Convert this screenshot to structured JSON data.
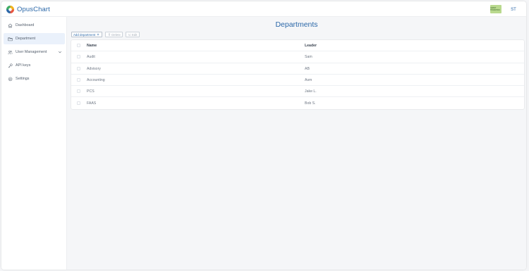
{
  "app": {
    "brand": "OpusChart",
    "org_logo_text": "GRANT THORNTON",
    "user_initials": "ST",
    "accent_color": "#2a67a8"
  },
  "sidebar": {
    "items": [
      {
        "label": "Dashboard",
        "icon": "home-icon"
      },
      {
        "label": "Department",
        "icon": "folder-icon",
        "active": true
      },
      {
        "label": "User Management",
        "icon": "users-icon",
        "expandable": true
      },
      {
        "label": "API keys",
        "icon": "key-icon"
      },
      {
        "label": "Settings",
        "icon": "gear-icon"
      }
    ]
  },
  "page": {
    "title": "Departments",
    "toolbar": {
      "add_label": "Add department",
      "delete_label": "Delete",
      "edit_label": "Edit"
    },
    "table": {
      "columns": [
        "Name",
        "Leader"
      ],
      "rows": [
        {
          "name": "Audit",
          "leader": "Sam"
        },
        {
          "name": "Advisory",
          "leader": "AB"
        },
        {
          "name": "Accounting",
          "leader": "Asm"
        },
        {
          "name": "PCS",
          "leader": "Jake L."
        },
        {
          "name": "FAAS",
          "leader": "Bob S."
        }
      ]
    }
  }
}
